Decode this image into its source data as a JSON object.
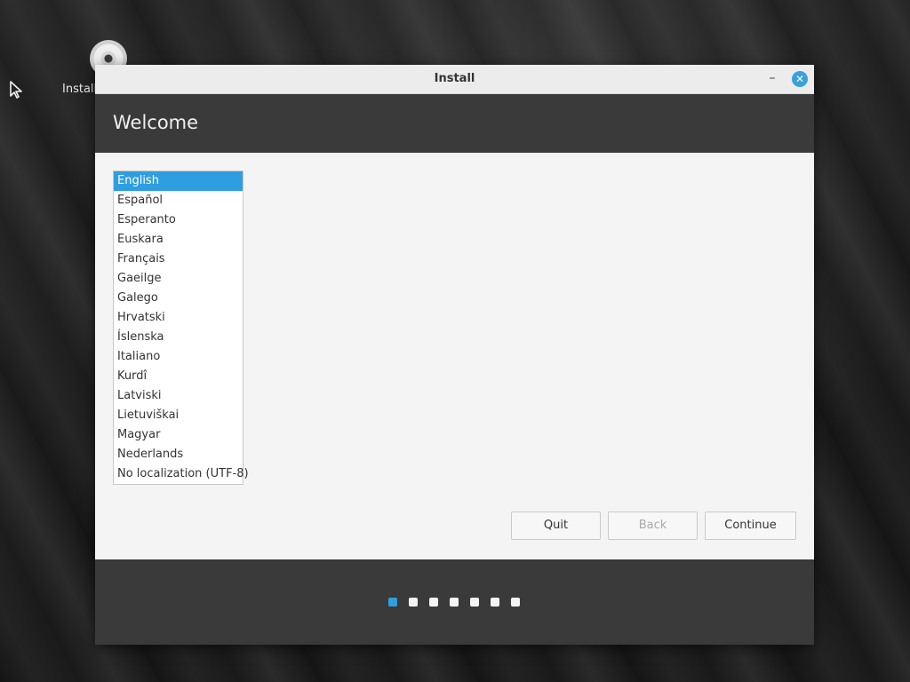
{
  "desktop": {
    "icon_label": "Install"
  },
  "window": {
    "title": "Install",
    "minimize_symbol": "–",
    "close_symbol": "✕"
  },
  "header": {
    "title": "Welcome"
  },
  "languages": {
    "selected": "English",
    "items": [
      "English",
      "Español",
      "Esperanto",
      "Euskara",
      "Français",
      "Gaeilge",
      "Galego",
      "Hrvatski",
      "Íslenska",
      "Italiano",
      "Kurdî",
      "Latviski",
      "Lietuviškai",
      "Magyar",
      "Nederlands",
      "No localization (UTF-8)"
    ]
  },
  "buttons": {
    "quit": "Quit",
    "back": "Back",
    "continue": "Continue"
  },
  "progress": {
    "total_steps": 7,
    "current_step": 1
  },
  "colors": {
    "accent": "#2f9ee0",
    "header_bg": "#3a3a3a"
  }
}
